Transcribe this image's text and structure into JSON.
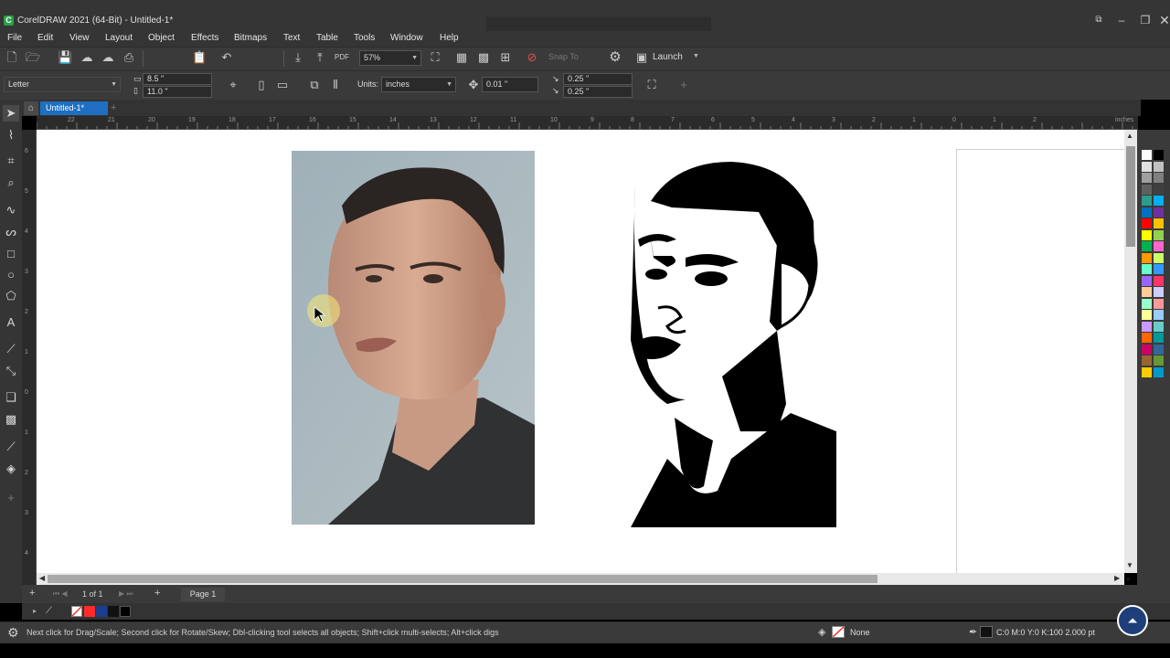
{
  "app": {
    "title": "CorelDRAW 2021 (64-Bit) - Untitled-1*",
    "logo_letter": "C"
  },
  "menu": [
    "File",
    "Edit",
    "View",
    "Layout",
    "Object",
    "Effects",
    "Bitmaps",
    "Text",
    "Table",
    "Tools",
    "Window",
    "Help"
  ],
  "toolbar": {
    "zoom": "57%",
    "snap_to": "Snap To",
    "launch": "Launch"
  },
  "property_bar": {
    "page_size": "Letter",
    "width": "8.5 \"",
    "height": "11.0 \"",
    "units_label": "Units:",
    "units_value": "inches",
    "nudge": "0.01 \"",
    "dup_x": "0.25 \"",
    "dup_y": "0.25 \""
  },
  "tabs": {
    "document": "Untitled-1*"
  },
  "ruler": {
    "h_ticks": [
      "22",
      "21",
      "20",
      "19",
      "18",
      "17",
      "16",
      "15",
      "14",
      "13",
      "12",
      "11",
      "10",
      "9",
      "8",
      "7",
      "6",
      "5",
      "4",
      "3",
      "2",
      "1",
      "0",
      "1",
      "2"
    ],
    "unit": "inches",
    "v_ticks": [
      "6",
      "5",
      "4",
      "3",
      "2",
      "1",
      "0",
      "1",
      "2",
      "3",
      "4"
    ]
  },
  "page_nav": {
    "page_count": "1 of 1",
    "page_tab": "Page 1"
  },
  "status": {
    "hint": "Next click for Drag/Scale; Second click for Rotate/Skew; Dbl-clicking tool selects all objects; Shift+click multi-selects; Alt+click digs",
    "fill": "None",
    "outline": "C:0 M:0 Y:0 K:100  2.000 pt"
  },
  "colors": {
    "accent": "#1e6fc2",
    "chrome": "#3a3a3a",
    "palette": [
      "#ffffff",
      "#000000",
      "#e0e0e0",
      "#c0c0c0",
      "#a0a0a0",
      "#808080",
      "#606060",
      "#404040",
      "#2a9d8f",
      "#00b0f0",
      "#0070c0",
      "#7030a0",
      "#ff0000",
      "#ffc000",
      "#ffff00",
      "#92d050",
      "#00b050",
      "#ff66cc",
      "#ff9900",
      "#ccff66",
      "#66ffcc",
      "#3399ff",
      "#9966ff",
      "#ff3366",
      "#ffcc99",
      "#ccccff",
      "#99ffcc",
      "#ff9999",
      "#ffff99",
      "#99ccff",
      "#cc99ff",
      "#66cccc",
      "#ff6600",
      "#009999",
      "#cc0066",
      "#336699",
      "#996633",
      "#669933",
      "#ffcc00",
      "#0099cc"
    ]
  }
}
